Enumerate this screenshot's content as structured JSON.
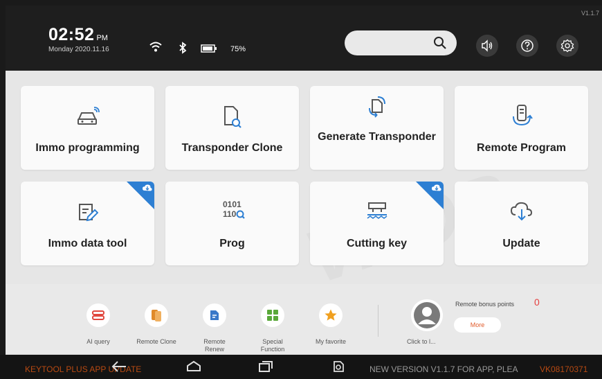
{
  "version": "V1.1.7",
  "status": {
    "time": "02:52",
    "ampm": "PM",
    "date": "Monday 2020.11.16",
    "battery": "75%"
  },
  "header_icons": [
    "wifi-icon",
    "bluetooth-icon",
    "battery-icon",
    "search-icon",
    "volume-icon",
    "help-icon",
    "settings-icon"
  ],
  "tiles": [
    {
      "label": "Immo programming",
      "icon": "car-icon"
    },
    {
      "label": "Transponder Clone",
      "icon": "document-search-icon"
    },
    {
      "label": "Generate Transponder",
      "icon": "transponder-generate-icon"
    },
    {
      "label": "Remote Program",
      "icon": "remote-sync-icon"
    },
    {
      "label": "Immo data tool",
      "icon": "edit-document-icon"
    },
    {
      "label": "Prog",
      "icon": "binary-search-icon"
    },
    {
      "label": "Cutting key",
      "icon": "key-cutting-icon"
    },
    {
      "label": "Update",
      "icon": "cloud-download-icon"
    }
  ],
  "bottom_tools": [
    {
      "label": "AI query",
      "icon": "ai-query-icon",
      "color": "#e0473e"
    },
    {
      "label": "Remote Clone",
      "icon": "remote-clone-icon",
      "color": "#e08a2a"
    },
    {
      "label": "Remote Renew",
      "icon": "remote-renew-icon",
      "color": "#3a78c8"
    },
    {
      "label": "Special Function",
      "icon": "special-function-icon",
      "color": "#5aa83a"
    },
    {
      "label": "My favorite",
      "icon": "star-icon",
      "color": "#f0a020"
    }
  ],
  "user": {
    "click_label": "Click to l...",
    "bonus_label": "Remote bonus points",
    "bonus_value": "0",
    "more_label": "More"
  },
  "ticker": {
    "left": "KEYTOOL PLUS APP UPDATE",
    "right": "NEW VERSION V1.1.7 FOR APP, PLEA",
    "code": "VK08170371"
  },
  "colors": {
    "accent_blue": "#2d7fd3",
    "ticker_orange": "#b84a12",
    "bonus_red": "#e54040"
  }
}
